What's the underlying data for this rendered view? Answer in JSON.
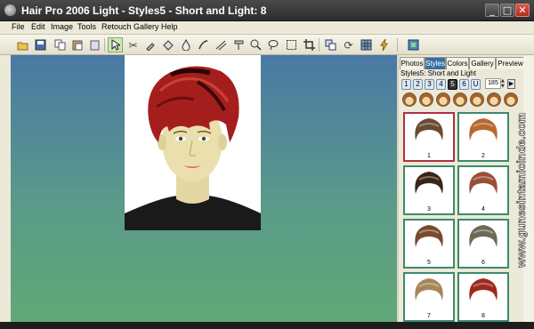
{
  "window": {
    "title": "Hair Pro 2006 Light - Styles5 - Short and Light: 8"
  },
  "menu": [
    "File",
    "Edit",
    "Image",
    "Tools",
    "Retouch",
    "Gallery",
    "Help"
  ],
  "toolbar_icons": [
    "open-folder-icon",
    "save-icon",
    "copy-icon",
    "paste-icon",
    "select-arrow-icon",
    "scissors-icon",
    "eyedropper-icon",
    "fill-icon",
    "drop-icon",
    "hair-brush-icon",
    "comb-icon",
    "tint-icon",
    "zoom-icon",
    "lasso-icon",
    "crop-icon",
    "transform-icon",
    "rotate-icon",
    "grid-icon",
    "flash-icon",
    "gallery-icon"
  ],
  "panel": {
    "tabs": [
      "Photos",
      "Styles",
      "Colors",
      "Gallery",
      "Preview"
    ],
    "selected_tab": "Styles",
    "heading": "Styles5: Short and Light",
    "page_buttons": [
      "1",
      "2",
      "3",
      "4",
      "5",
      "6",
      "U"
    ],
    "selected_page": "5",
    "size_value": "185",
    "thumbnails": [
      {
        "label": "1",
        "hair": "#6b4a34",
        "selected": true
      },
      {
        "label": "2",
        "hair": "#b8692f",
        "selected": false
      },
      {
        "label": "3",
        "hair": "#3a2518",
        "selected": false
      },
      {
        "label": "4",
        "hair": "#9a4e38",
        "selected": false
      },
      {
        "label": "5",
        "hair": "#7a4a2c",
        "selected": false
      },
      {
        "label": "6",
        "hair": "#6c6a56",
        "selected": false
      },
      {
        "label": "7",
        "hair": "#a8865a",
        "selected": false
      },
      {
        "label": "8",
        "hair": "#9e2a1c",
        "selected": false
      }
    ]
  },
  "watermark": "www.gunesintamicinde.com"
}
